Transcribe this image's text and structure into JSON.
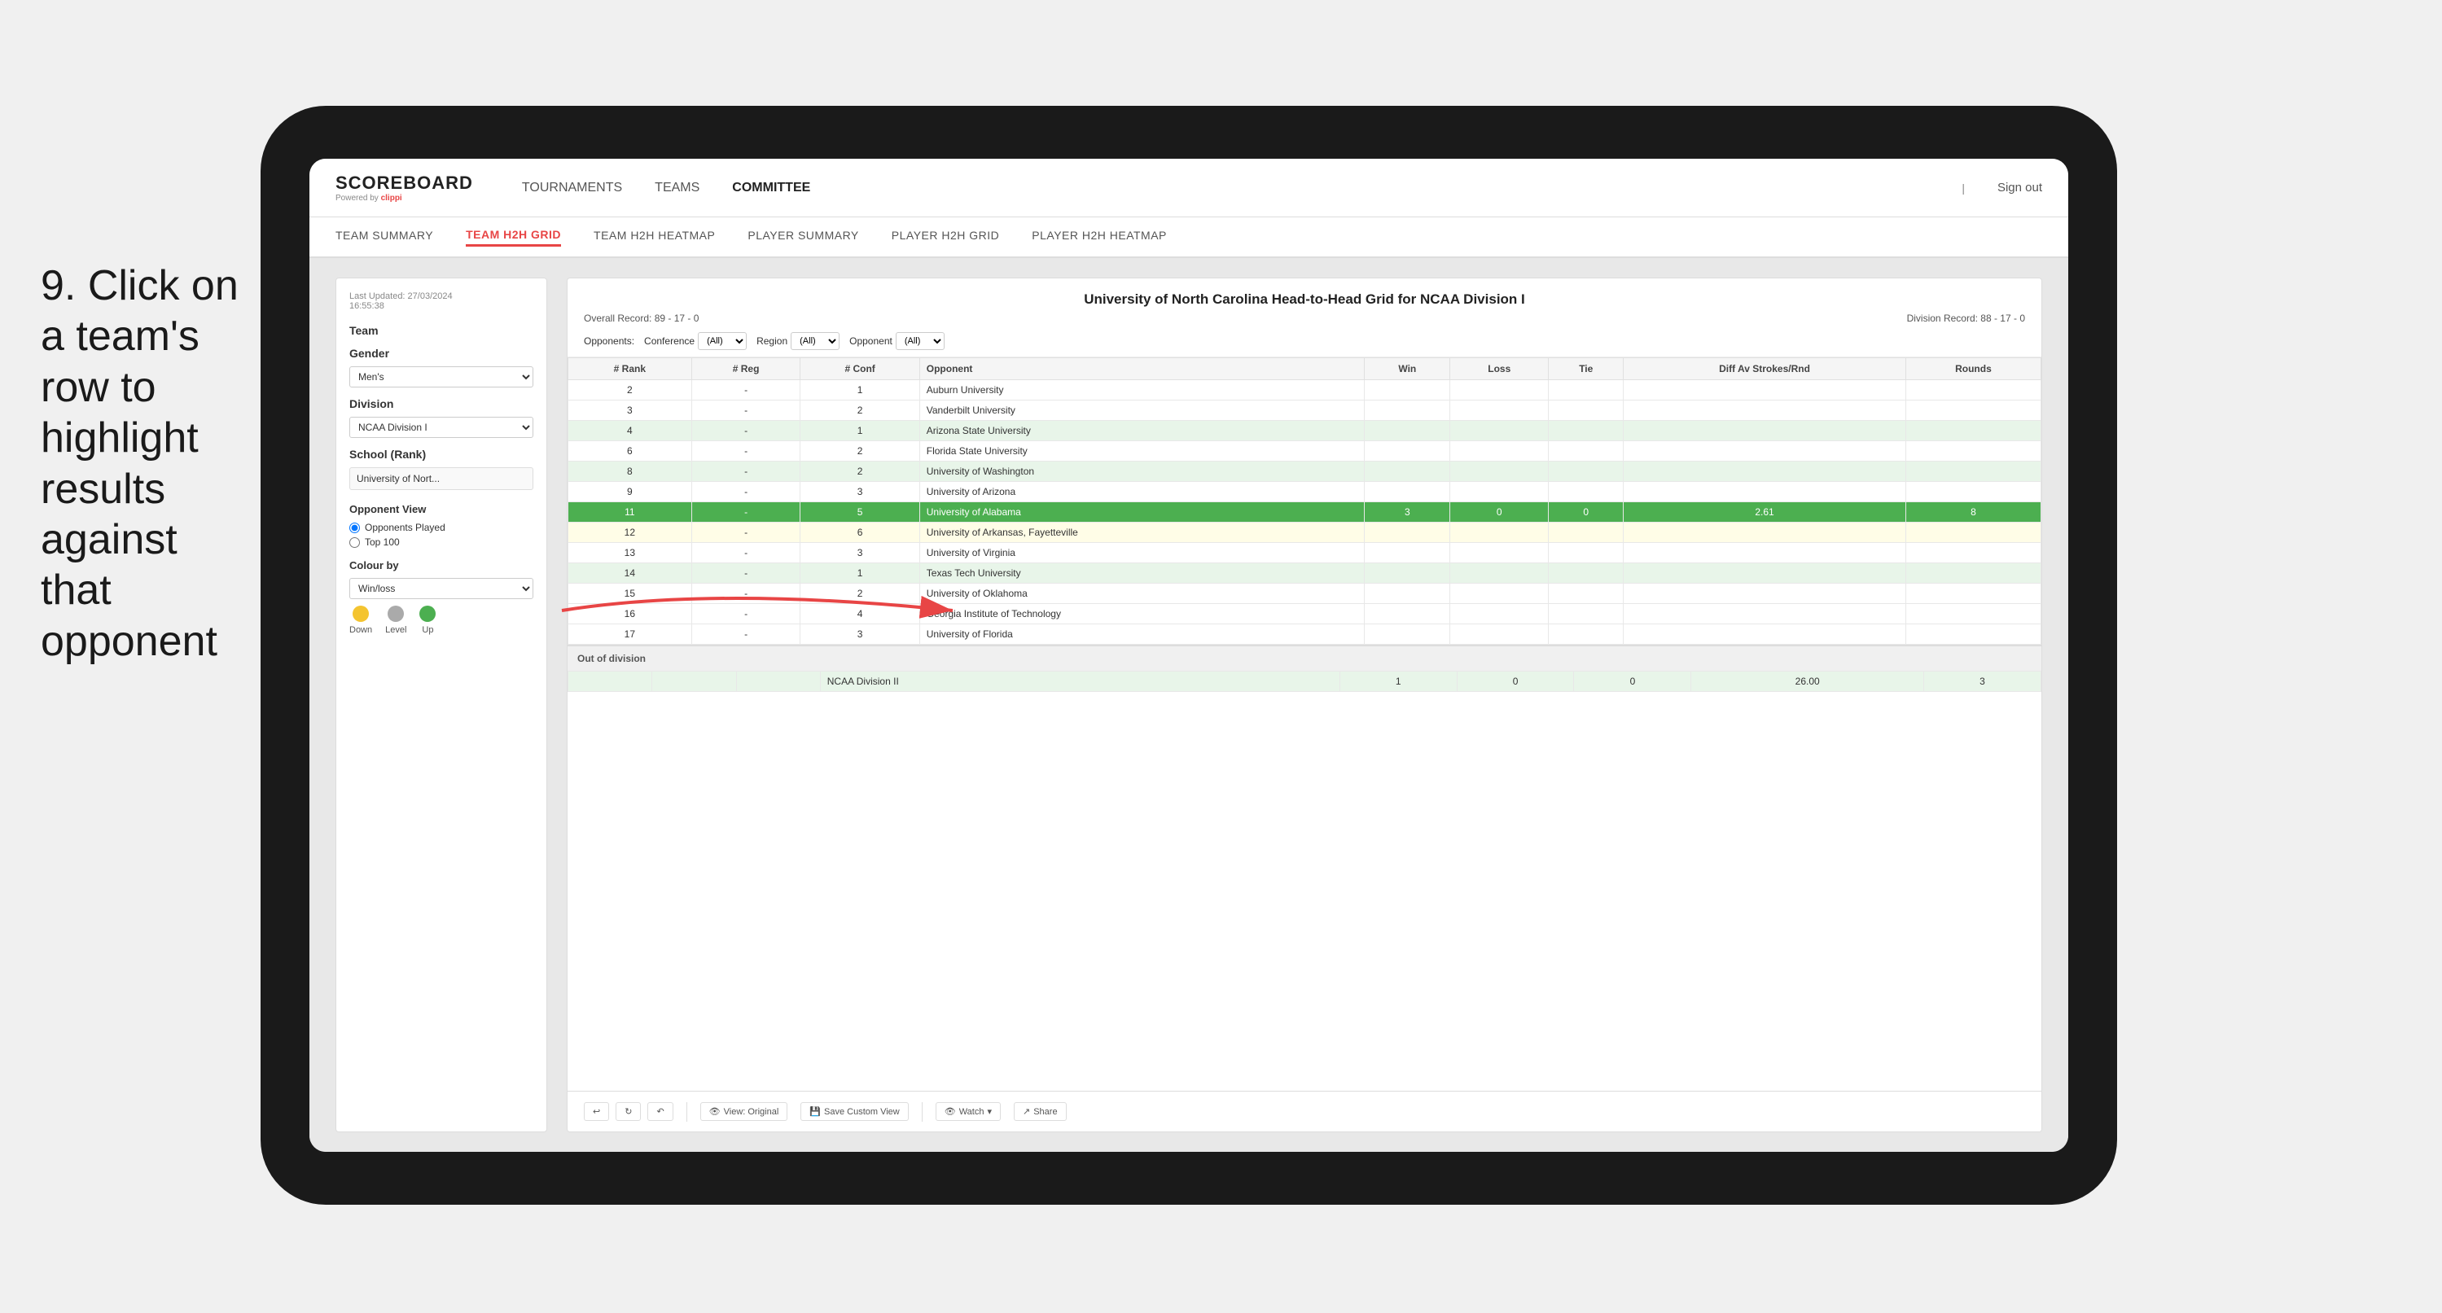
{
  "instruction": {
    "text": "9. Click on a team's row to highlight results against that opponent"
  },
  "nav": {
    "logo": "SCOREBOARD",
    "powered_by": "Powered by clippi",
    "links": [
      "TOURNAMENTS",
      "TEAMS",
      "COMMITTEE"
    ],
    "sign_out": "Sign out"
  },
  "sub_nav": {
    "links": [
      "TEAM SUMMARY",
      "TEAM H2H GRID",
      "TEAM H2H HEATMAP",
      "PLAYER SUMMARY",
      "PLAYER H2H GRID",
      "PLAYER H2H HEATMAP"
    ],
    "active": "TEAM H2H GRID"
  },
  "left_panel": {
    "last_updated_label": "Last Updated: 27/03/2024",
    "time": "16:55:38",
    "team_label": "Team",
    "gender_label": "Gender",
    "gender_value": "Men's",
    "division_label": "Division",
    "division_value": "NCAA Division I",
    "school_label": "School (Rank)",
    "school_value": "University of Nort...",
    "opponent_view_label": "Opponent View",
    "radio1": "Opponents Played",
    "radio2": "Top 100",
    "colour_by_label": "Colour by",
    "colour_by_value": "Win/loss",
    "legend": [
      {
        "label": "Down",
        "color": "down"
      },
      {
        "label": "Level",
        "color": "level"
      },
      {
        "label": "Up",
        "color": "up"
      }
    ]
  },
  "grid": {
    "title": "University of North Carolina Head-to-Head Grid for NCAA Division I",
    "overall_record": "Overall Record: 89 - 17 - 0",
    "division_record": "Division Record: 88 - 17 - 0",
    "filters": {
      "opponents_label": "Opponents:",
      "conference_label": "Conference",
      "conference_value": "(All)",
      "region_label": "Region",
      "region_value": "(All)",
      "opponent_label": "Opponent",
      "opponent_value": "(All)"
    },
    "columns": [
      "# Rank",
      "# Reg",
      "# Conf",
      "Opponent",
      "Win",
      "Loss",
      "Tie",
      "Diff Av Strokes/Rnd",
      "Rounds"
    ],
    "rows": [
      {
        "rank": "2",
        "reg": "-",
        "conf": "1",
        "opponent": "Auburn University",
        "win": "",
        "loss": "",
        "tie": "",
        "diff": "",
        "rounds": "",
        "style": "normal"
      },
      {
        "rank": "3",
        "reg": "-",
        "conf": "2",
        "opponent": "Vanderbilt University",
        "win": "",
        "loss": "",
        "tie": "",
        "diff": "",
        "rounds": "",
        "style": "normal"
      },
      {
        "rank": "4",
        "reg": "-",
        "conf": "1",
        "opponent": "Arizona State University",
        "win": "",
        "loss": "",
        "tie": "",
        "diff": "",
        "rounds": "",
        "style": "light-green"
      },
      {
        "rank": "6",
        "reg": "-",
        "conf": "2",
        "opponent": "Florida State University",
        "win": "",
        "loss": "",
        "tie": "",
        "diff": "",
        "rounds": "",
        "style": "normal"
      },
      {
        "rank": "8",
        "reg": "-",
        "conf": "2",
        "opponent": "University of Washington",
        "win": "",
        "loss": "",
        "tie": "",
        "diff": "",
        "rounds": "",
        "style": "light-green"
      },
      {
        "rank": "9",
        "reg": "-",
        "conf": "3",
        "opponent": "University of Arizona",
        "win": "",
        "loss": "",
        "tie": "",
        "diff": "",
        "rounds": "",
        "style": "normal"
      },
      {
        "rank": "11",
        "reg": "-",
        "conf": "5",
        "opponent": "University of Alabama",
        "win": "3",
        "loss": "0",
        "tie": "0",
        "diff": "2.61",
        "rounds": "8",
        "style": "highlighted"
      },
      {
        "rank": "12",
        "reg": "-",
        "conf": "6",
        "opponent": "University of Arkansas, Fayetteville",
        "win": "",
        "loss": "",
        "tie": "",
        "diff": "",
        "rounds": "",
        "style": "light-yellow"
      },
      {
        "rank": "13",
        "reg": "-",
        "conf": "3",
        "opponent": "University of Virginia",
        "win": "",
        "loss": "",
        "tie": "",
        "diff": "",
        "rounds": "",
        "style": "normal"
      },
      {
        "rank": "14",
        "reg": "-",
        "conf": "1",
        "opponent": "Texas Tech University",
        "win": "",
        "loss": "",
        "tie": "",
        "diff": "",
        "rounds": "",
        "style": "light-green"
      },
      {
        "rank": "15",
        "reg": "-",
        "conf": "2",
        "opponent": "University of Oklahoma",
        "win": "",
        "loss": "",
        "tie": "",
        "diff": "",
        "rounds": "",
        "style": "normal"
      },
      {
        "rank": "16",
        "reg": "-",
        "conf": "4",
        "opponent": "Georgia Institute of Technology",
        "win": "",
        "loss": "",
        "tie": "",
        "diff": "",
        "rounds": "",
        "style": "normal"
      },
      {
        "rank": "17",
        "reg": "-",
        "conf": "3",
        "opponent": "University of Florida",
        "win": "",
        "loss": "",
        "tie": "",
        "diff": "",
        "rounds": "",
        "style": "normal"
      }
    ],
    "out_of_division_label": "Out of division",
    "out_of_division_row": {
      "label": "NCAA Division II",
      "win": "1",
      "loss": "0",
      "tie": "0",
      "diff": "26.00",
      "rounds": "3"
    }
  },
  "toolbar": {
    "view_label": "View: Original",
    "save_custom": "Save Custom View",
    "watch_label": "Watch",
    "share_label": "Share"
  }
}
